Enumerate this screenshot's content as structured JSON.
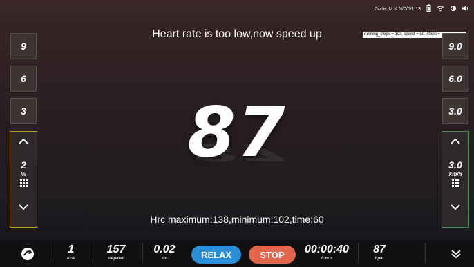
{
  "status": {
    "code": "Code: M K N/0/0/L 13",
    "icons": [
      "battery-icon",
      "wifi-icon",
      "brightness-icon",
      "volume-icon"
    ]
  },
  "banner": "Heart rate is too low,now speed up",
  "debug_text": "running_steps = 1CI, speed = 50. steps =",
  "heart_rate_display": "87",
  "hrc_info": "Hrc maximum:138,minimum:102,time:60",
  "incline": {
    "presets": [
      "9",
      "6",
      "3"
    ],
    "value": "2",
    "unit": "%",
    "up_icon": "chevron-up-icon",
    "down_icon": "chevron-down-icon",
    "keypad_icon": "keypad-icon"
  },
  "speed": {
    "presets": [
      "9.0",
      "6.0",
      "3.0"
    ],
    "value": "3.0",
    "unit": "km/h",
    "up_icon": "chevron-up-icon",
    "down_icon": "chevron-down-icon",
    "keypad_icon": "keypad-icon"
  },
  "bottom_bar": {
    "kcal": {
      "value": "1",
      "unit": "kcal"
    },
    "cadence": {
      "value": "157",
      "unit": "step/min"
    },
    "distance": {
      "value": "0.02",
      "unit": "km"
    },
    "relax_label": "RELAX",
    "stop_label": "STOP",
    "time": {
      "value": "00:00:40",
      "unit": "h:m:s"
    },
    "heart_rate": {
      "value": "87",
      "unit": "bpm"
    }
  },
  "colors": {
    "relax": "#2a8fd8",
    "stop": "#e2664c",
    "incline_border": "#c79a2a",
    "speed_border": "#3c8f4a"
  }
}
